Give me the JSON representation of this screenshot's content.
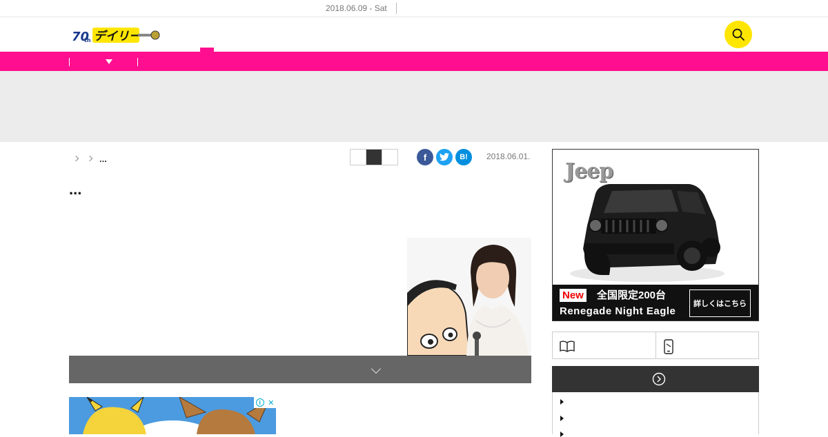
{
  "topbar": {
    "date": "2018.06.09 - Sat"
  },
  "header": {
    "logo_mark": "70th",
    "logo_text": "デイリー"
  },
  "breadcrumb": {
    "current": "..."
  },
  "article": {
    "date": "2018.06.01.",
    "title": "..."
  },
  "share": {
    "facebook": "f",
    "twitter": "t",
    "hatena": "B!"
  },
  "side_ad": {
    "brand": "Jeep",
    "badge": "New",
    "headline": "全国限定200台",
    "model": "Renegade Night Eagle",
    "cta": "詳しくはこちら"
  },
  "bottom_ad": {
    "adchoices_info": "i",
    "adchoices_close": "✕"
  },
  "colors": {
    "accent": "#ff0f8f",
    "search": "#ffe600",
    "dark": "#333333"
  }
}
